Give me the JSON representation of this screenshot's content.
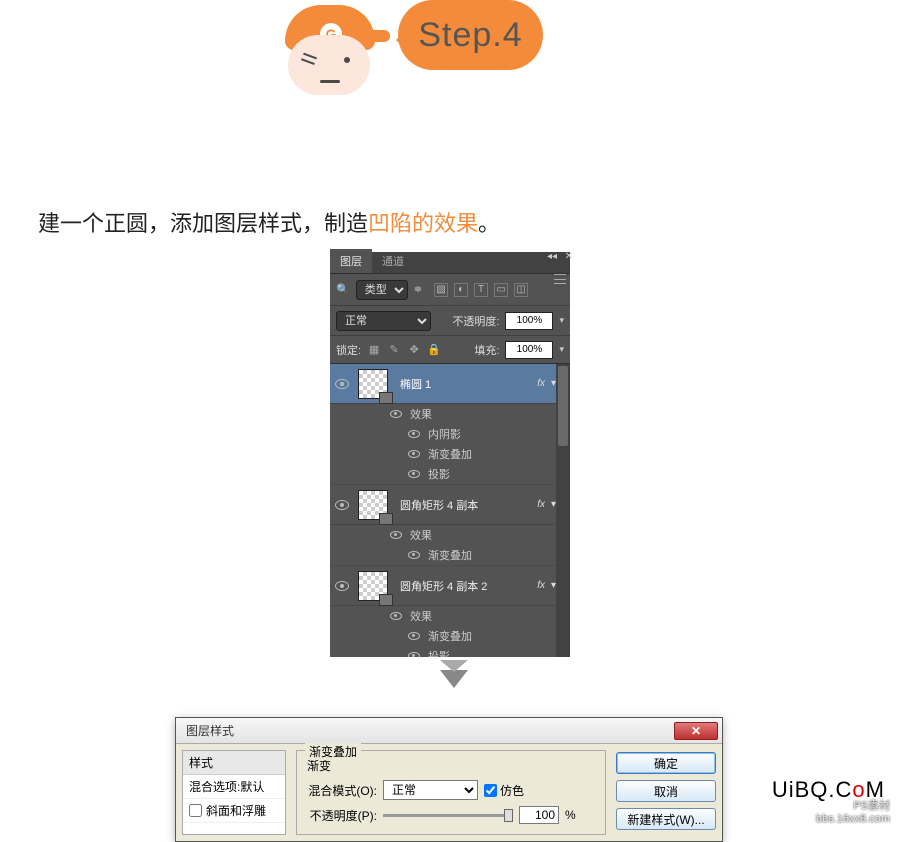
{
  "step": {
    "label": "Step.4",
    "logo": "G"
  },
  "instruction": {
    "pre": "建一个正圆，添加图层样式，制造",
    "highlight": "凹陷的效果",
    "post": "。"
  },
  "layers_panel": {
    "tabs": {
      "layers": "图层",
      "channels": "通道"
    },
    "filter_label": "类型",
    "blend": {
      "mode": "正常",
      "opacity_label": "不透明度:",
      "opacity": "100%"
    },
    "lock": {
      "label": "锁定:",
      "fill_label": "填充:",
      "fill": "100%"
    },
    "layers": [
      {
        "name": "椭圆 1",
        "selected": true,
        "fx": [
          "效果",
          "内阴影",
          "渐变叠加",
          "投影"
        ]
      },
      {
        "name": "圆角矩形 4 副本",
        "selected": false,
        "fx": [
          "效果",
          "渐变叠加"
        ]
      },
      {
        "name": "圆角矩形 4 副本 2",
        "selected": false,
        "fx": [
          "效果",
          "渐变叠加",
          "投影"
        ]
      }
    ]
  },
  "dialog": {
    "title": "图层样式",
    "left": {
      "header": "样式",
      "items": [
        "混合选项:默认",
        "斜面和浮雕"
      ]
    },
    "section": {
      "legend": "渐变叠加",
      "sub": "渐变",
      "blend_label": "混合模式(O):",
      "blend_value": "正常",
      "dither_label": "仿色",
      "opacity_label": "不透明度(P):",
      "opacity_value": "100",
      "opacity_unit": "%"
    },
    "buttons": {
      "ok": "确定",
      "cancel": "取消",
      "new_style": "新建样式(W)..."
    }
  },
  "watermark": {
    "brand_pre": "UiBQ.C",
    "brand_o": "o",
    "brand_post": "M",
    "line1": "PS素材",
    "line2": "bbs.16xx8.com"
  }
}
